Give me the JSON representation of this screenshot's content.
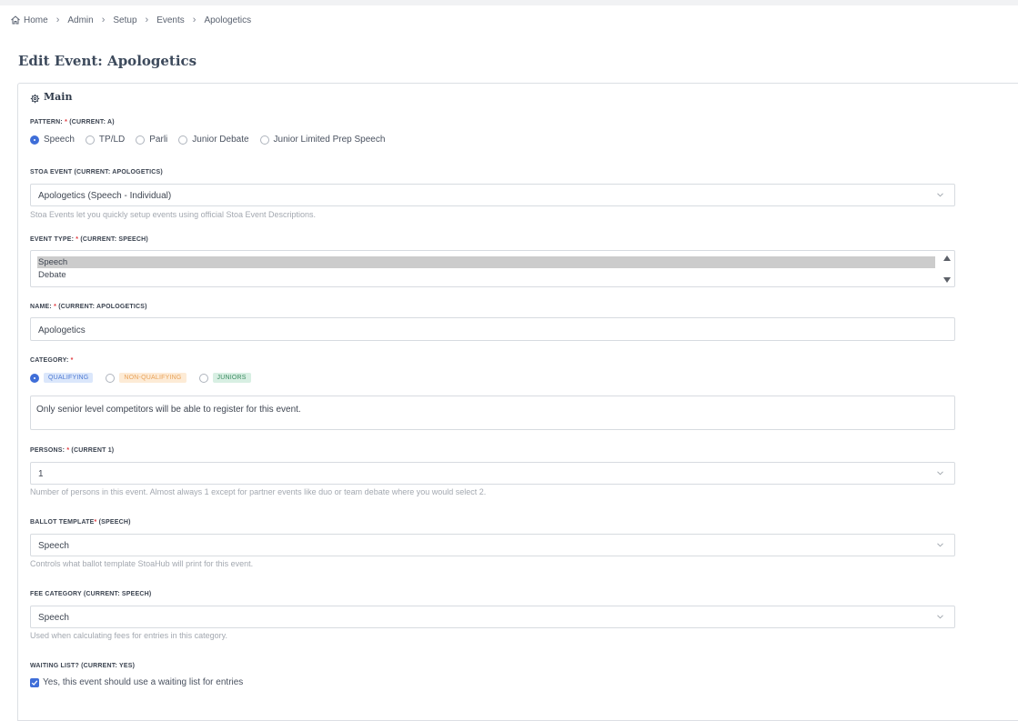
{
  "breadcrumb": [
    "Home",
    "Admin",
    "Setup",
    "Events",
    "Apologetics"
  ],
  "page_title": "Edit Event: Apologetics",
  "section_title": "Main",
  "pattern": {
    "label": "PATTERN:",
    "required": "*",
    "current": "(CURRENT: A)",
    "options": [
      "Speech",
      "TP/LD",
      "Parli",
      "Junior Debate",
      "Junior Limited Prep Speech"
    ],
    "selected": "Speech"
  },
  "stoa_event": {
    "label": "STOA EVENT (CURRENT: APOLOGETICS)",
    "value": "Apologetics (Speech - Individual)",
    "help": "Stoa Events let you quickly setup events using official Stoa Event Descriptions."
  },
  "event_type": {
    "label": "EVENT TYPE:",
    "required": "*",
    "current": "(CURRENT: SPEECH)",
    "options": [
      "Speech",
      "Debate"
    ],
    "selected": "Speech"
  },
  "name": {
    "label": "NAME:",
    "required": "*",
    "current": "(CURRENT: APOLOGETICS)",
    "value": "Apologetics"
  },
  "category": {
    "label": "CATEGORY:",
    "required": "*",
    "options": [
      "QUALIFYING",
      "NON-QUALIFYING",
      "JUNIORS"
    ],
    "selected": "QUALIFYING",
    "description": "Only senior level competitors will be able to register for this event."
  },
  "persons": {
    "label": "PERSONS:",
    "required": "*",
    "current": "(CURRENT 1)",
    "value": "1",
    "help": "Number of persons in this event. Almost always 1 except for partner events like duo or team debate where you would select 2."
  },
  "ballot_template": {
    "label": "BALLOT TEMPLATE",
    "required": "*",
    "current": "(SPEECH)",
    "value": "Speech",
    "help": "Controls what ballot template StoaHub will print for this event."
  },
  "fee_category": {
    "label": "FEE CATEGORY (CURRENT: SPEECH)",
    "value": "Speech",
    "help": "Used when calculating fees for entries in this category."
  },
  "waiting_list": {
    "label": "WAITING LIST? (CURRENT: YES)",
    "checkbox_label": "Yes, this event should use a waiting list for entries",
    "checked": true
  },
  "colors": {
    "accent": "#3f6ed8",
    "required": "#e0383e",
    "qualifying": "#4f7ad2",
    "non_qualifying": "#e8a35a",
    "juniors": "#3e8c62"
  }
}
